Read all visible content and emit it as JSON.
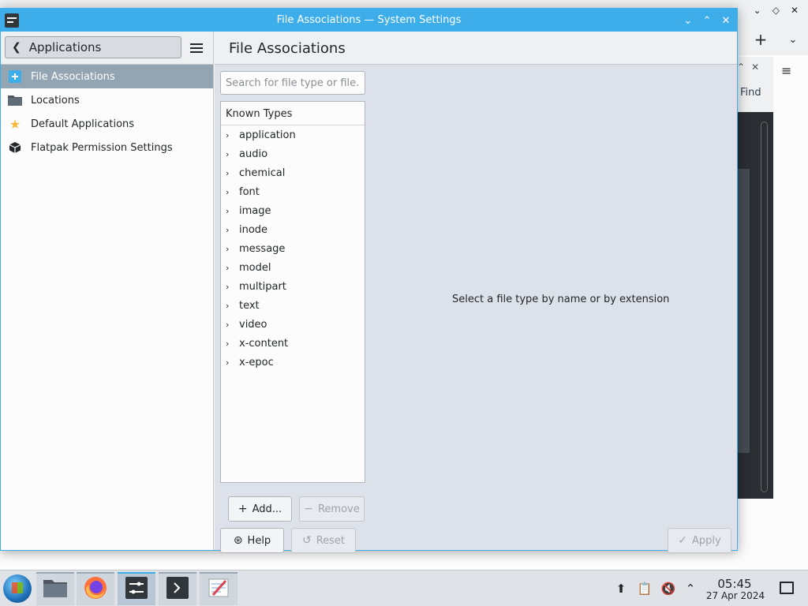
{
  "window": {
    "title": "File Associations — System Settings"
  },
  "sidebar": {
    "back_label": "Applications",
    "items": [
      {
        "label": "File Associations",
        "selected": true
      },
      {
        "label": "Locations"
      },
      {
        "label": "Default Applications"
      },
      {
        "label": "Flatpak Permission Settings"
      }
    ]
  },
  "main": {
    "page_title": "File Associations",
    "search_placeholder": "Search for file type or file...",
    "tree_header": "Known Types",
    "types": [
      "application",
      "audio",
      "chemical",
      "font",
      "image",
      "inode",
      "message",
      "model",
      "multipart",
      "text",
      "video",
      "x-content",
      "x-epoc"
    ],
    "empty_message": "Select a file type by name or by extension",
    "add_label": "Add...",
    "remove_label": "Remove",
    "help_label": "Help",
    "reset_label": "Reset",
    "apply_label": "Apply"
  },
  "background_window": {
    "find_label": "Find"
  },
  "taskbar": {
    "time": "05:45",
    "date": "27 Apr 2024"
  },
  "colors": {
    "accent": "#3daee9",
    "selection": "#93a4b3"
  }
}
